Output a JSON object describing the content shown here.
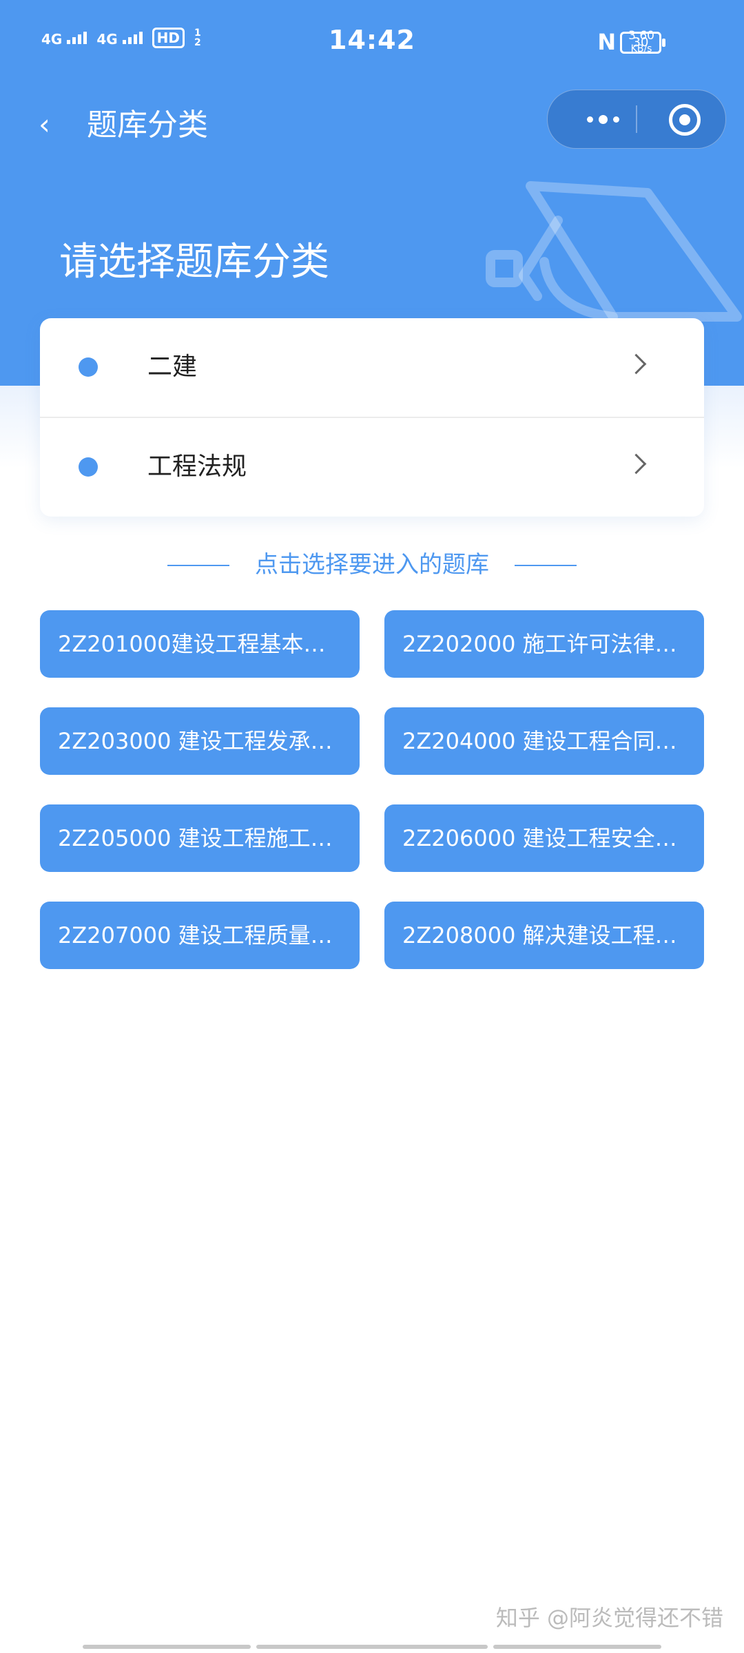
{
  "status_bar": {
    "time": "14:42",
    "net1": "4G",
    "net2": "4G",
    "hd": "HD",
    "hd_sub": "1 2",
    "nfc": "N",
    "speed_value": "3.60",
    "speed_unit": "KB/s",
    "battery": "30"
  },
  "nav": {
    "back_icon": "‹",
    "title": "题库分类",
    "more_icon": "more-dots-icon",
    "target_icon": "target-icon"
  },
  "heading": "请选择题库分类",
  "categories": [
    {
      "label": "二建"
    },
    {
      "label": "工程法规"
    }
  ],
  "prompt": "点击选择要进入的题库",
  "banks": [
    "2Z201000建设工程基本…",
    "2Z202000 施工许可法律…",
    "2Z203000 建设工程发承…",
    "2Z204000 建设工程合同…",
    "2Z205000 建设工程施工…",
    "2Z206000 建设工程安全…",
    "2Z207000 建设工程质量…",
    "2Z208000 解决建设工程…"
  ],
  "watermark": "知乎 @阿炎觉得还不错",
  "colors": {
    "primary": "#4e98f0",
    "white": "#ffffff",
    "text": "#222222"
  }
}
